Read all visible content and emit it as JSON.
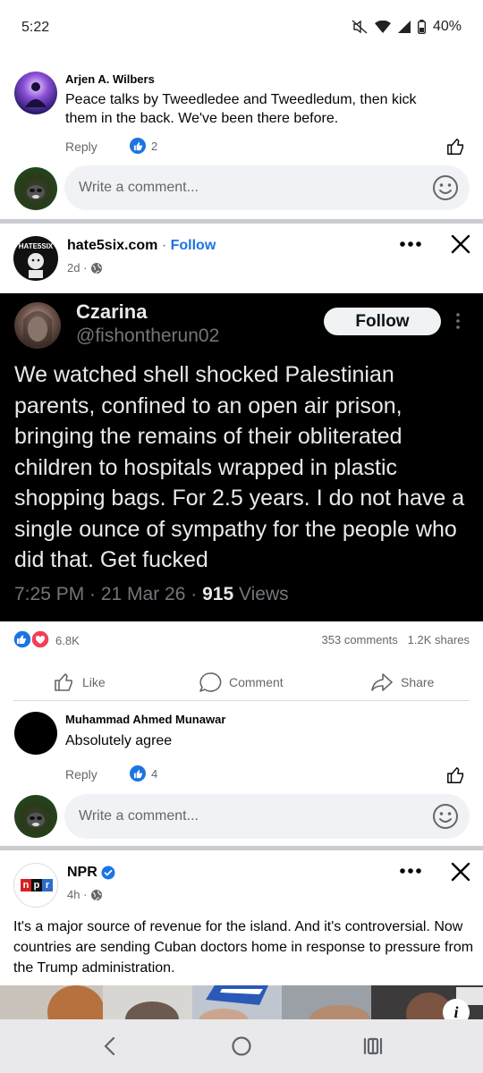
{
  "status_bar": {
    "time": "5:22",
    "battery": "40%"
  },
  "comment1": {
    "author": "Arjen A. Wilbers",
    "text_line1": "Peace talks by Tweedledee and Tweedledum, then kick",
    "text_line2": "them in the back. We've been there before.",
    "reply_label": "Reply",
    "like_count": "2"
  },
  "write_comment_1": {
    "placeholder": "Write a comment..."
  },
  "post1": {
    "page_name": "hate5six.com",
    "separator": " · ",
    "follow_label": "Follow",
    "time": "2d ·",
    "tweet": {
      "name": "Czarina",
      "handle": "@fishontherun02",
      "follow_label": "Follow",
      "text": "We watched shell shocked Palestinian parents, confined to an open air prison, bringing the remains of their obliterated children to hospitals wrapped in plastic shopping bags. For 2.5 years. I do not have a single ounce of sympathy for the people who did that. Get fucked",
      "meta_time": "7:25 PM · 21 Mar 26 · ",
      "meta_views_count": "915",
      "meta_views_label": " Views"
    },
    "reactions_count": "6.8K",
    "comments_count": "353 comments",
    "shares_count": "1.2K shares",
    "actions": {
      "like": "Like",
      "comment": "Comment",
      "share": "Share"
    }
  },
  "comment2": {
    "author": "Muhammad Ahmed Munawar",
    "text": "Absolutely agree",
    "reply_label": "Reply",
    "like_count": "4"
  },
  "write_comment_2": {
    "placeholder": "Write a comment..."
  },
  "post2": {
    "page_name": "NPR",
    "logo_letters": [
      "n",
      "p",
      "r"
    ],
    "time": "4h ·",
    "text": "It's a major source of revenue for the island. And it's controversial. Now countries are sending Cuban doctors home in response to pressure from the Trump administration."
  },
  "colors": {
    "accent": "#1b74e4",
    "love": "#f33e58",
    "tweet_bg": "#000000"
  },
  "icons": [
    "mute-icon",
    "wifi-icon",
    "signal-icon",
    "battery-icon",
    "like-icon",
    "emoji-icon",
    "globe-icon",
    "close-icon",
    "more-icon",
    "comment-icon",
    "share-icon",
    "verified-icon",
    "info-icon",
    "back-icon",
    "home-icon",
    "recents-icon"
  ]
}
